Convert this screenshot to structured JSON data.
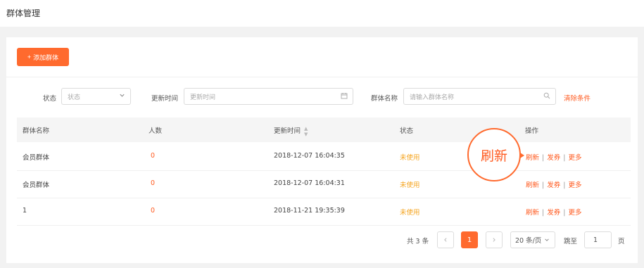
{
  "page": {
    "title": "群体管理"
  },
  "toolbar": {
    "add_label": "添加群体",
    "add_icon": "+"
  },
  "filters": {
    "status_label": "状态",
    "status_placeholder": "状态",
    "time_label": "更新时间",
    "time_placeholder": "更新时间",
    "name_label": "群体名称",
    "name_placeholder": "请输入群体名称",
    "clear_label": "清除条件"
  },
  "table": {
    "headers": [
      "群体名称",
      "人数",
      "更新时间",
      "状态",
      "操作"
    ],
    "rows": [
      {
        "name": "会员群体",
        "count": "0",
        "time": "2018-12-07 16:04:35",
        "status": "未使用"
      },
      {
        "name": "会员群体",
        "count": "0",
        "time": "2018-12-07 16:04:31",
        "status": "未使用"
      },
      {
        "name": "1",
        "count": "0",
        "time": "2018-11-21 19:35:39",
        "status": "未使用"
      }
    ],
    "actions": {
      "refresh": "刷新",
      "coupon": "发券",
      "more": "更多",
      "separator": "|"
    }
  },
  "pagination": {
    "total": "共 3 条",
    "current_page": "1",
    "page_size": "20 条/页",
    "jump_label": "跳至",
    "jump_value": "1",
    "page_unit": "页"
  },
  "callout": {
    "text": "刷新"
  },
  "colors": {
    "accent": "#ff6a2e",
    "status_unused": "#f5a623"
  }
}
